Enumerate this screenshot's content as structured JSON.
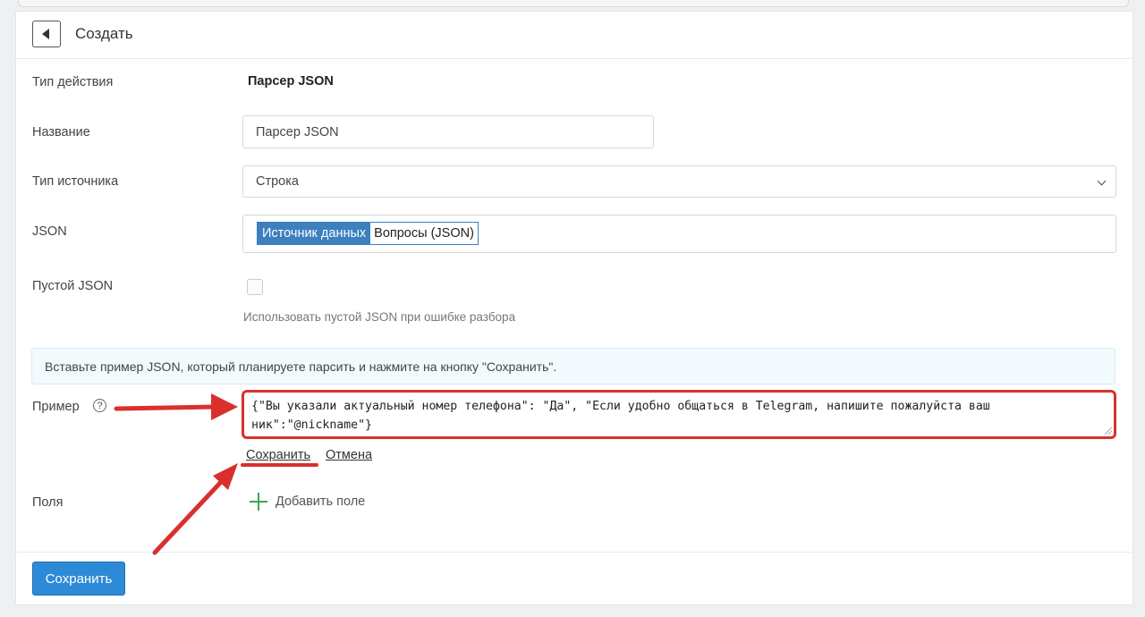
{
  "header": {
    "title": "Создать",
    "back_icon": "back-arrow-icon"
  },
  "form": {
    "action_type": {
      "label": "Тип действия",
      "value": "Парсер JSON"
    },
    "name": {
      "label": "Название",
      "value": "Парсер JSON"
    },
    "source_type": {
      "label": "Тип источника",
      "value": "Строка"
    },
    "json": {
      "label": "JSON",
      "tag_key": "Источник данных",
      "tag_value": "Вопросы (JSON)"
    },
    "empty_json": {
      "label": "Пустой JSON",
      "checked": false,
      "hint": "Использовать пустой JSON при ошибке разбора"
    },
    "info": "Вставьте пример JSON, который планируете парсить и нажмите на кнопку \"Сохранить\".",
    "example": {
      "label": "Пример",
      "help": "?",
      "value": "{\"Вы указали актуальный номер телефона\": \"Да\", \"Если удобно общаться в Telegram, напишите пожалуйста ваш ник\":\"@nickname\"}",
      "save_link": "Сохранить",
      "cancel_link": "Отмена"
    },
    "fields": {
      "label": "Поля",
      "add_label": "Добавить поле"
    }
  },
  "footer": {
    "save_label": "Сохранить"
  },
  "colors": {
    "annotation": "#d9302e",
    "primary": "#2d8ad6",
    "tag": "#3d80bf",
    "add": "#3aa64a"
  }
}
